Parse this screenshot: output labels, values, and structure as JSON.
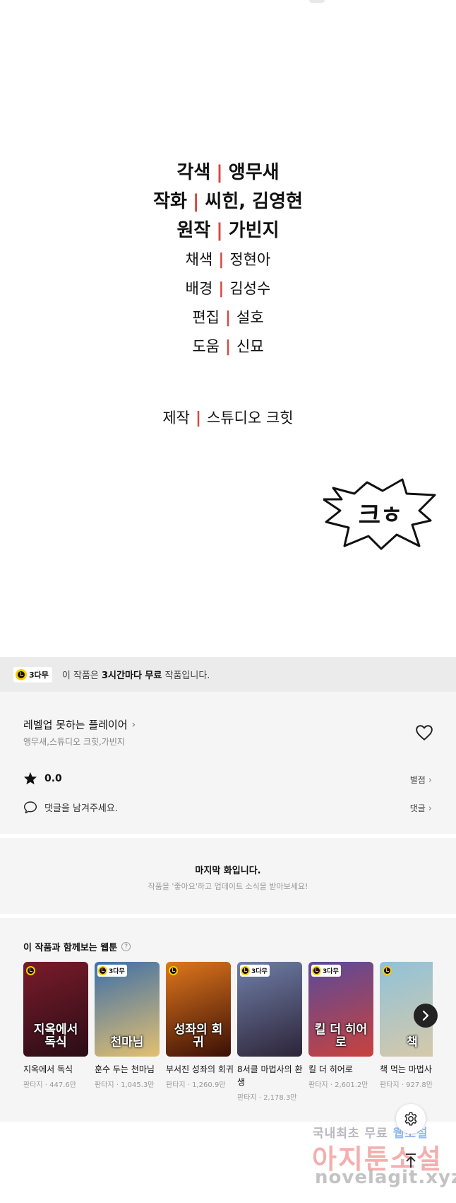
{
  "credits": {
    "lines": [
      {
        "role": "각색",
        "name": "앵무새"
      },
      {
        "role": "작화",
        "name": "씨힌, 김영현"
      },
      {
        "role": "원작",
        "name": "가빈지"
      },
      {
        "role": "채색",
        "name": "정현아"
      },
      {
        "role": "배경",
        "name": "김성수"
      },
      {
        "role": "편집",
        "name": "설호"
      },
      {
        "role": "도움",
        "name": "신묘"
      }
    ],
    "production": {
      "role": "제작",
      "name": "스튜디오 크힛"
    },
    "divider": "|",
    "sfx_text": "크ㅎ"
  },
  "free_banner": {
    "badge": "3다무",
    "text_before": "이 작품은 ",
    "text_bold": "3시간마다 무료",
    "text_after": " 작품입니다."
  },
  "series": {
    "title": "레벨업 못하는 플레이어",
    "authors": "앵무새,스튜디오 크힛,가빈지",
    "rating": "0.0",
    "rating_link": "별점",
    "comment_prompt": "댓글을 남겨주세요.",
    "comment_link": "댓글"
  },
  "last_episode": {
    "title": "마지막 화입니다.",
    "subtitle": "작품을 '좋아요'하고 업데이트 소식을 받아보세요!"
  },
  "recommendations": {
    "heading": "이 작품과 함께보는 웹툰",
    "help": "?",
    "items": [
      {
        "name": "지옥에서 독식",
        "meta": "판타지 · 447.6만",
        "badge": "",
        "cover_text": "지옥에서 독식",
        "color_a": "#7a1b2a",
        "color_b": "#2a0d16"
      },
      {
        "name": "훈수 두는 천마님",
        "meta": "판타지 · 1,045.3만",
        "badge": "3다무",
        "cover_text": "천마님",
        "color_a": "#3d6fa8",
        "color_b": "#e3c070"
      },
      {
        "name": "부서진 성좌의 회귀",
        "meta": "판타지 · 1,260.9만",
        "badge": "",
        "cover_text": "성좌의 회귀",
        "color_a": "#e0771c",
        "color_b": "#3a0f06"
      },
      {
        "name": "8서클 마법사의 환생",
        "meta": "판타지 · 2,178.3만",
        "badge": "3다무",
        "cover_text": "",
        "color_a": "#6f7fa8",
        "color_b": "#2d2438"
      },
      {
        "name": "킬 더 히어로",
        "meta": "판타지 · 2,601.2만",
        "badge": "3다무",
        "cover_text": "킬 더 히어로",
        "color_a": "#5a4a9a",
        "color_b": "#c9423d"
      },
      {
        "name": "책 먹는 마법사",
        "meta": "판타지 · 927.8만",
        "badge": "",
        "cover_text": "책",
        "color_a": "#8fc2d9",
        "color_b": "#d9c9a8"
      }
    ]
  },
  "watermark": {
    "line1_a": "국내최초 무료 ",
    "line1_b": "웹소설",
    "line2": "아지툰소설",
    "line3": "novelagit.xyz"
  },
  "icons": {
    "heart": "heart-icon",
    "star": "star-icon",
    "comment": "comment-icon",
    "next": "chevron-right-icon",
    "gear": "gear-icon",
    "top": "arrow-up-icon"
  },
  "colors": {
    "divider_red": "#d9463f",
    "badge_yellow": "#ffcc00",
    "panel_bg": "#f5f5f5",
    "banner_bg": "#ebebeb"
  }
}
